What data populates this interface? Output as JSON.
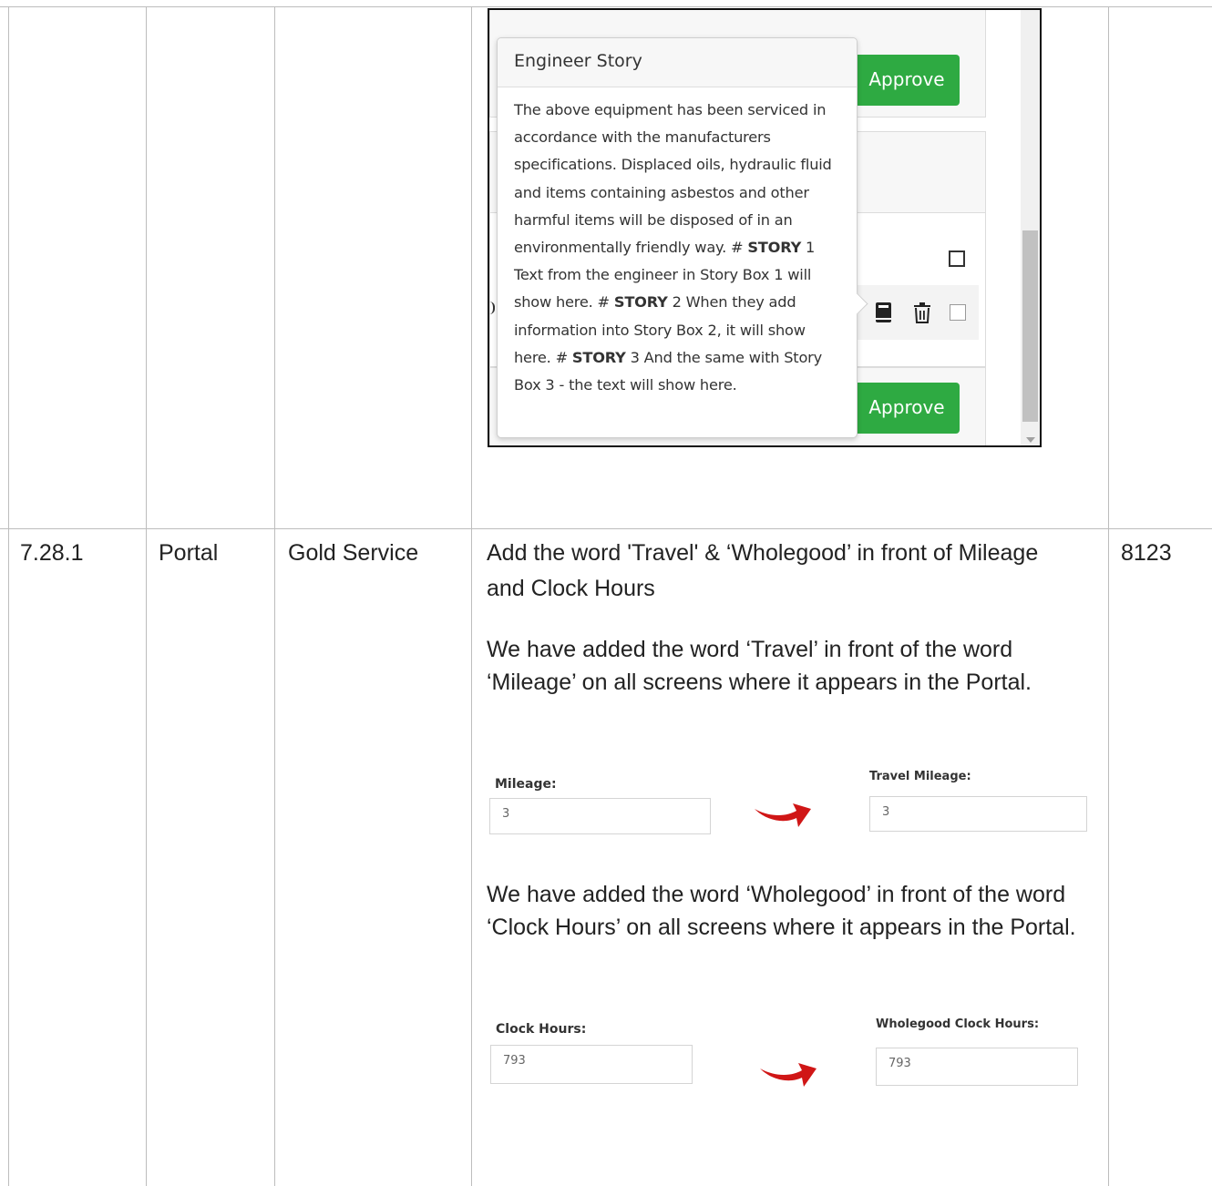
{
  "embedded_story": {
    "popover_title": "Engineer Story",
    "p1": "The above equipment has been serviced in accordance with the manufacturers specifications. Displaced oils, hydraulic fluid and items containing asbestos and other harmful items will be disposed of in an environmentally friendly way. # ",
    "story_word": "STORY",
    "p2": " 1 Text from the engineer in Story Box 1 will show here. # ",
    "p3": " 2 When they add information into Story Box 2, it will show here. # ",
    "p4": " 3 And the same with Story Box 3 - the text will show here.",
    "approve_label": "Approve",
    "icons": [
      "book-icon",
      "trash-icon",
      "checkbox-icon"
    ]
  },
  "row": {
    "ref": "7.28.1",
    "area": "Portal",
    "service": "Gold Service",
    "heading": "Add the word 'Travel' & ‘Wholegood’ in front of Mileage and Clock Hours",
    "id": "8123",
    "para1": "We have added the word ‘Travel’ in front of the word ‘Mileage’ on all screens where it appears in the Portal.",
    "para2": "We have added the word ‘Wholegood’ in front of the word ‘Clock Hours’ on all screens where it appears in the Portal.",
    "mileage_before": {
      "label": "Mileage:",
      "value": "3"
    },
    "mileage_after": {
      "label": "Travel Mileage:",
      "value": "3"
    },
    "hours_before": {
      "label": "Clock Hours:",
      "value": "793"
    },
    "hours_after": {
      "label": "Wholegood Clock Hours:",
      "value": "793"
    }
  },
  "colors": {
    "approve_green": "#2eaa42",
    "arrow_red": "#d01616",
    "grid": "#bdbdbd"
  }
}
